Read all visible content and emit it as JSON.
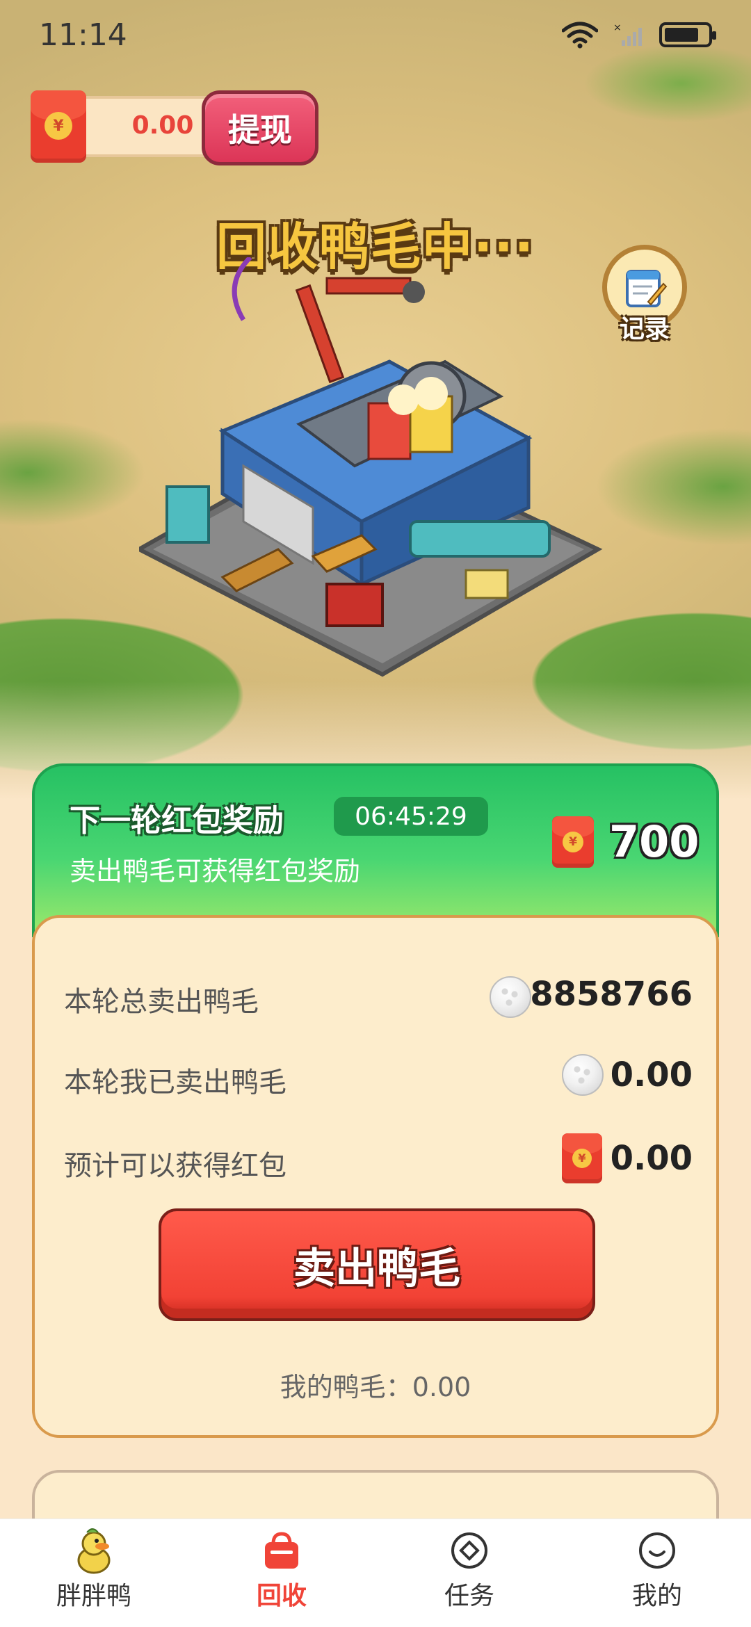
{
  "status_bar": {
    "time": "11:14"
  },
  "balance": {
    "value": "0.00",
    "withdraw_label": "提现",
    "icon": "red-envelope-icon"
  },
  "scene": {
    "title": "回收鸭毛中···",
    "records_label": "记录"
  },
  "reward": {
    "title": "下一轮红包奖励",
    "countdown": "06:45:29",
    "subtitle": "卖出鸭毛可获得红包奖励",
    "amount": "700"
  },
  "stats": {
    "rows": [
      {
        "label": "本轮总卖出鸭毛",
        "value": "8858766",
        "icon": "feather-ball-icon"
      },
      {
        "label": "本轮我已卖出鸭毛",
        "value": "0.00",
        "icon": "feather-ball-icon"
      },
      {
        "label": "预计可以获得红包",
        "value": "0.00",
        "icon": "red-envelope-icon"
      }
    ],
    "sell_button": "卖出鸭毛",
    "my_feathers": "我的鸭毛：0.00"
  },
  "bottom_nav": {
    "items": [
      {
        "label": "胖胖鸭",
        "icon": "duck-icon"
      },
      {
        "label": "回收",
        "icon": "bag-icon"
      },
      {
        "label": "任务",
        "icon": "target-icon"
      },
      {
        "label": "我的",
        "icon": "smile-icon"
      }
    ],
    "active": "回收"
  },
  "colors": {
    "accent_red": "#f04438",
    "green_header": "#26c163",
    "card_bg": "#fdedcc",
    "card_border": "#d99a4c"
  }
}
